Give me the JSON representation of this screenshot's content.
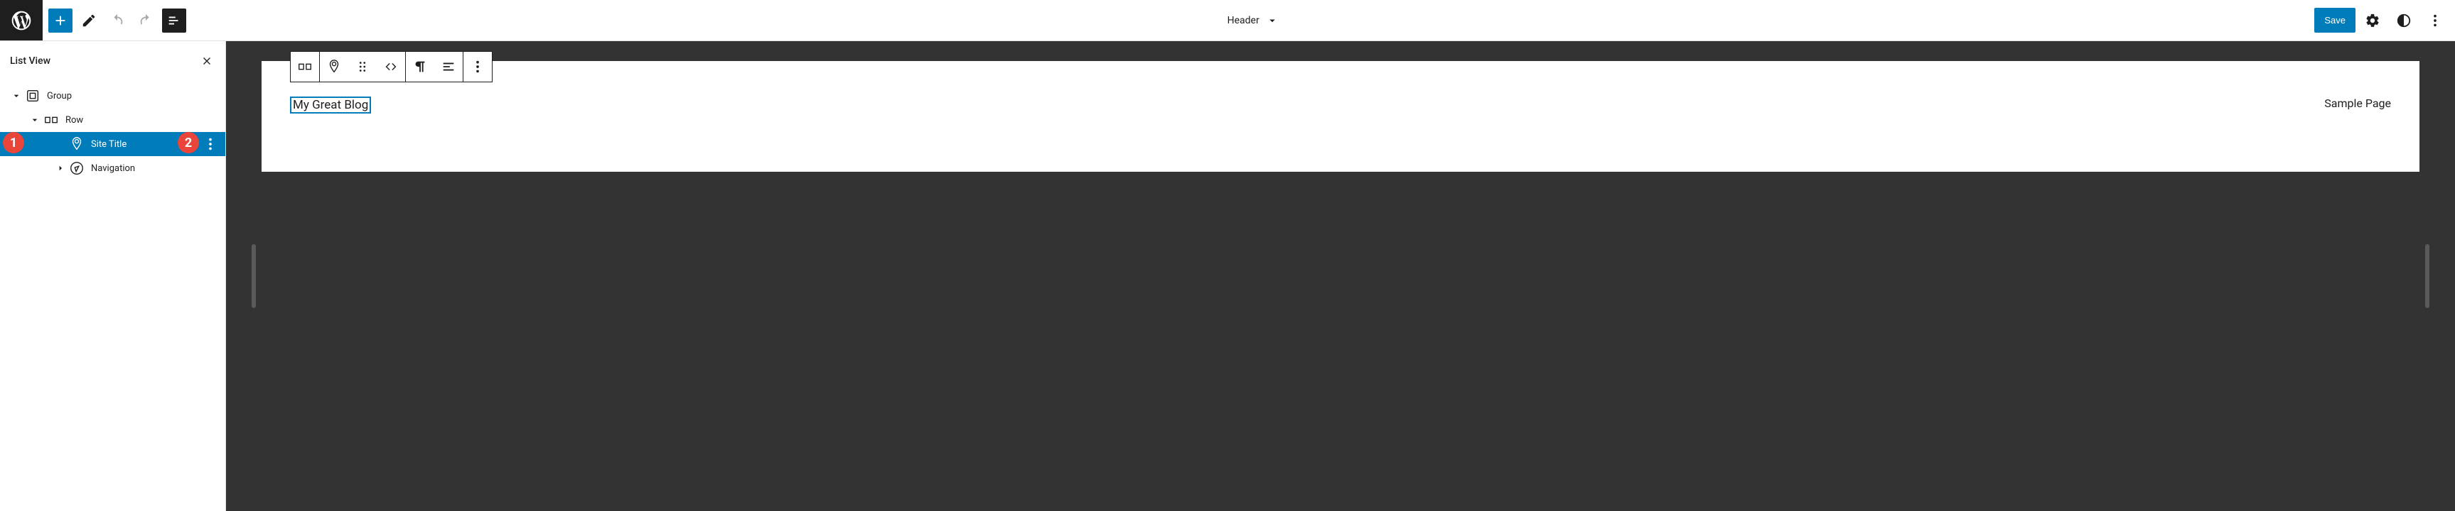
{
  "topbar": {
    "document_title": "Header",
    "save_label": "Save"
  },
  "list_view": {
    "title": "List View",
    "tree": [
      {
        "label": "Group",
        "indent": 0,
        "icon": "group",
        "has_children": true,
        "expanded": true,
        "selected": false
      },
      {
        "label": "Row",
        "indent": 1,
        "icon": "row",
        "has_children": true,
        "expanded": true,
        "selected": false
      },
      {
        "label": "Site Title",
        "indent": 2,
        "icon": "site-title",
        "has_children": false,
        "expanded": false,
        "selected": true
      },
      {
        "label": "Navigation",
        "indent": 2,
        "icon": "navigation",
        "has_children": true,
        "expanded": false,
        "selected": false
      }
    ]
  },
  "annotations": [
    {
      "n": "1"
    },
    {
      "n": "2"
    }
  ],
  "canvas": {
    "site_title": "My Great Blog",
    "nav_items": [
      "Sample Page"
    ]
  }
}
